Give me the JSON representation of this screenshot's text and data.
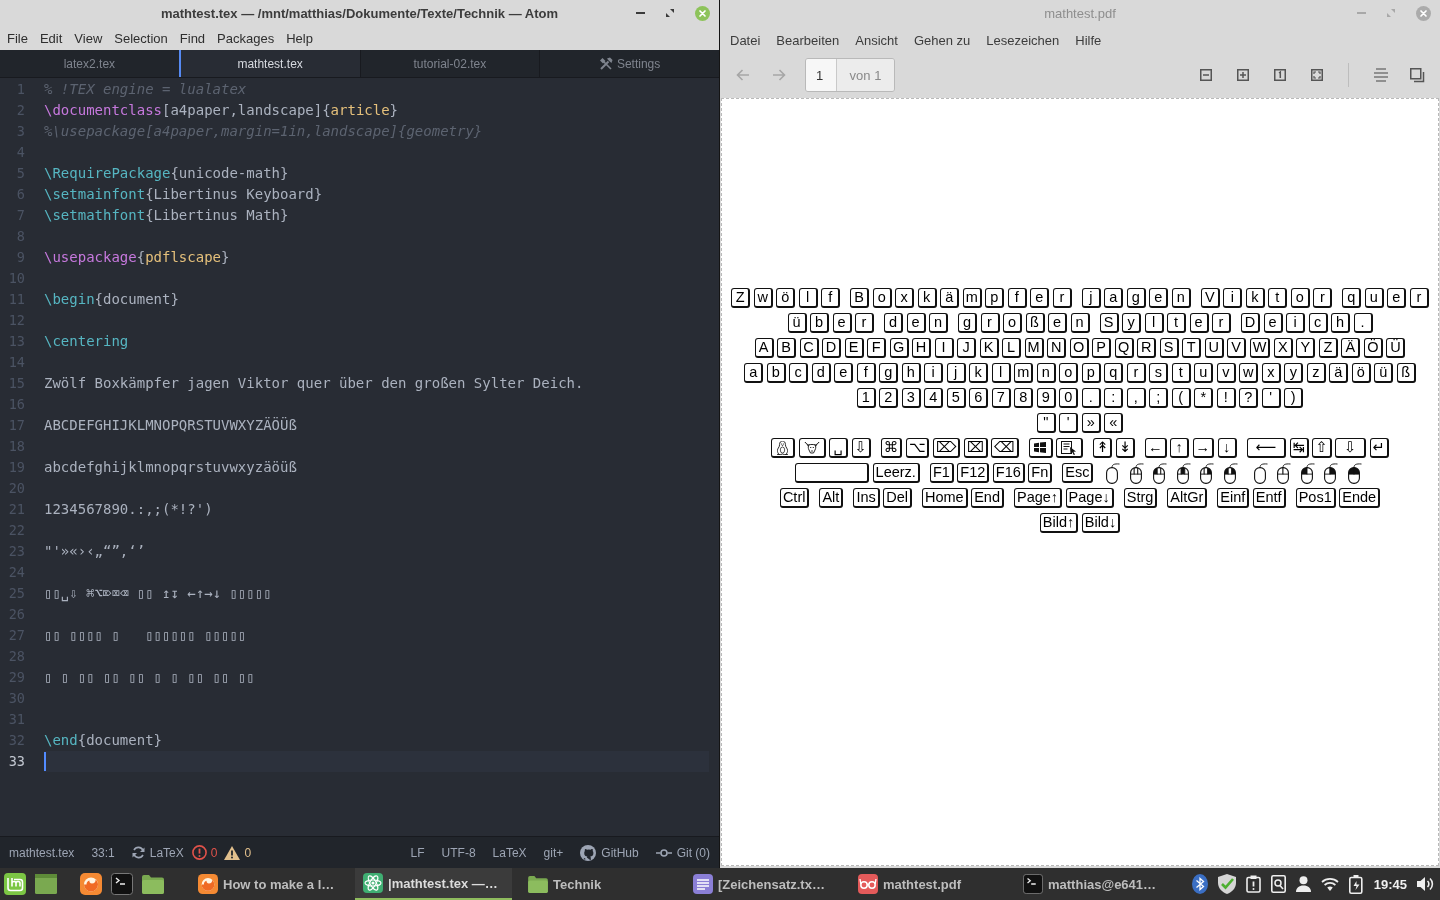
{
  "atom": {
    "window": {
      "title": "mathtest.tex — /mnt/matthias/Dokumente/Texte/Technik — Atom",
      "active": true
    },
    "menu": [
      "File",
      "Edit",
      "View",
      "Selection",
      "Find",
      "Packages",
      "Help"
    ],
    "tabs": [
      {
        "kind": "file",
        "label": "latex2.tex",
        "selected": false
      },
      {
        "kind": "file",
        "label": "mathtest.tex",
        "selected": true
      },
      {
        "kind": "file",
        "label": "tutorial-02.tex",
        "selected": false
      },
      {
        "kind": "settings",
        "label": "Settings",
        "selected": false
      }
    ],
    "lines": [
      {
        "number": "1",
        "current": false,
        "tokens": [
          {
            "kind": "comment",
            "text": "% !TEX engine = lualatex"
          }
        ]
      },
      {
        "number": "2",
        "current": false,
        "tokens": [
          {
            "kind": "keyword",
            "text": "\\documentclass"
          },
          {
            "kind": "text",
            "text": "[a4paper,landscape]{"
          },
          {
            "kind": "argument",
            "text": "article"
          },
          {
            "kind": "text",
            "text": "}"
          }
        ]
      },
      {
        "number": "3",
        "current": false,
        "tokens": [
          {
            "kind": "comment",
            "text": "%\\usepackage[a4paper,margin=1in,landscape]{geometry}"
          }
        ]
      },
      {
        "number": "4",
        "current": false
      },
      {
        "number": "5",
        "current": false,
        "tokens": [
          {
            "kind": "function",
            "text": "\\RequirePackage"
          },
          {
            "kind": "text",
            "text": "{unicode-math}"
          }
        ]
      },
      {
        "number": "6",
        "current": false,
        "tokens": [
          {
            "kind": "function",
            "text": "\\setmainfont"
          },
          {
            "kind": "text",
            "text": "{Libertinus Keyboard}"
          }
        ]
      },
      {
        "number": "7",
        "current": false,
        "tokens": [
          {
            "kind": "function",
            "text": "\\setmathfont"
          },
          {
            "kind": "text",
            "text": "{Libertinus Math}"
          }
        ]
      },
      {
        "number": "8",
        "current": false
      },
      {
        "number": "9",
        "current": false,
        "tokens": [
          {
            "kind": "keyword",
            "text": "\\usepackage"
          },
          {
            "kind": "text",
            "text": "{"
          },
          {
            "kind": "argument",
            "text": "pdflscape"
          },
          {
            "kind": "text",
            "text": "}"
          }
        ]
      },
      {
        "number": "10",
        "current": false
      },
      {
        "number": "11",
        "current": false,
        "tokens": [
          {
            "kind": "function",
            "text": "\\begin"
          },
          {
            "kind": "text",
            "text": "{document}"
          }
        ]
      },
      {
        "number": "12",
        "current": false
      },
      {
        "number": "13",
        "current": false,
        "tokens": [
          {
            "kind": "function",
            "text": "\\centering"
          }
        ]
      },
      {
        "number": "14",
        "current": false
      },
      {
        "number": "15",
        "current": false,
        "tokens": [
          {
            "kind": "text",
            "text": "Zwölf Boxkämpfer jagen Viktor quer über den großen Sylter Deich."
          }
        ]
      },
      {
        "number": "16",
        "current": false
      },
      {
        "number": "17",
        "current": false,
        "tokens": [
          {
            "kind": "text",
            "text": "ABCDEFGHIJKLMNOPQRSTUVWXYZÄÖÜß"
          }
        ]
      },
      {
        "number": "18",
        "current": false
      },
      {
        "number": "19",
        "current": false,
        "tokens": [
          {
            "kind": "text",
            "text": "abcdefghijklmnopqrstuvwxyzäöüß"
          }
        ]
      },
      {
        "number": "20",
        "current": false
      },
      {
        "number": "21",
        "current": false,
        "tokens": [
          {
            "kind": "text",
            "text": "1234567890.:,;(*!?')"
          }
        ]
      },
      {
        "number": "22",
        "current": false
      },
      {
        "number": "23",
        "current": false,
        "tokens": [
          {
            "kind": "text",
            "text": "\"'»«›‹„“”‚‘’"
          }
        ]
      },
      {
        "number": "24",
        "current": false
      },
      {
        "number": "25",
        "current": false,
        "tokens": [
          {
            "kind": "text",
            "text": "▯▯␣⇩ ⌘⌥⌦⌧⌫ ▯▯ ↥↧ ←↑→↓ ▯▯▯▯▯"
          }
        ]
      },
      {
        "number": "26",
        "current": false
      },
      {
        "number": "27",
        "current": false,
        "tokens": [
          {
            "kind": "text",
            "text": "▯▯ ▯▯▯▯ ▯   ▯▯▯▯▯▯ ▯▯▯▯▯"
          }
        ]
      },
      {
        "number": "28",
        "current": false
      },
      {
        "number": "29",
        "current": false,
        "tokens": [
          {
            "kind": "text",
            "text": "▯ ▯ ▯▯ ▯▯ ▯▯ ▯ ▯ ▯▯ ▯▯ ▯▯"
          }
        ]
      },
      {
        "number": "30",
        "current": false
      },
      {
        "number": "31",
        "current": false
      },
      {
        "number": "32",
        "current": false,
        "tokens": [
          {
            "kind": "function",
            "text": "\\end"
          },
          {
            "kind": "text",
            "text": "{document}"
          }
        ]
      },
      {
        "number": "33",
        "current": true
      }
    ],
    "status_bar": {
      "file": "mathtest.tex",
      "position": "33:1",
      "build": "LaTeX",
      "errors": "0",
      "warnings": "0",
      "line_ending": "LF",
      "encoding": "UTF-8",
      "grammar": "LaTeX",
      "git_plus": "git+",
      "github": "GitHub",
      "git": "Git (0)"
    }
  },
  "reader": {
    "window": {
      "title": "mathtest.pdf",
      "active": false
    },
    "menu": [
      "Datei",
      "Bearbeiten",
      "Ansicht",
      "Gehen zu",
      "Lesezeichen",
      "Hilfe"
    ],
    "toolbar": {
      "nav": [
        {
          "kind": "back",
          "disabled": true
        },
        {
          "kind": "forward",
          "disabled": true
        }
      ],
      "page": "1",
      "page_count": "von 1"
    },
    "keyboard": {
      "rows": [
        {
          "groups": [
            {
              "keys": [
                "Z",
                "w",
                "ö",
                "l",
                "f"
              ]
            },
            {
              "keys": [
                "B",
                "o",
                "x",
                "k",
                "ä",
                "m",
                "p",
                "f",
                "e",
                "r"
              ]
            },
            {
              "keys": [
                "j",
                "a",
                "g",
                "e",
                "n"
              ]
            },
            {
              "keys": [
                "V",
                "i",
                "k",
                "t",
                "o",
                "r"
              ]
            },
            {
              "keys": [
                "q",
                "u",
                "e",
                "r"
              ]
            }
          ]
        },
        {
          "groups": [
            {
              "keys": [
                "ü",
                "b",
                "e",
                "r"
              ]
            },
            {
              "keys": [
                "d",
                "e",
                "n"
              ]
            },
            {
              "keys": [
                "g",
                "r",
                "o",
                "ß",
                "e",
                "n"
              ]
            },
            {
              "keys": [
                "S",
                "y",
                "l",
                "t",
                "e",
                "r"
              ]
            },
            {
              "keys": [
                "D",
                "e",
                "i",
                "c",
                "h",
                "."
              ]
            }
          ]
        },
        {
          "groups": [
            {
              "keys": [
                "A",
                "B",
                "C",
                "D",
                "E",
                "F",
                "G",
                "H",
                "I",
                "J",
                "K",
                "L",
                "M",
                "N",
                "O",
                "P",
                "Q",
                "R",
                "S",
                "T",
                "U",
                "V",
                "W",
                "X",
                "Y",
                "Z",
                "Ä",
                "Ö",
                "Ü"
              ]
            }
          ]
        },
        {
          "groups": [
            {
              "keys": [
                "a",
                "b",
                "c",
                "d",
                "e",
                "f",
                "g",
                "h",
                "i",
                "j",
                "k",
                "l",
                "m",
                "n",
                "o",
                "p",
                "q",
                "r",
                "s",
                "t",
                "u",
                "v",
                "w",
                "x",
                "y",
                "z",
                "ä",
                "ö",
                "ü",
                "ß"
              ]
            }
          ]
        },
        {
          "groups": [
            {
              "keys": [
                "1",
                "2",
                "3",
                "4",
                "5",
                "6",
                "7",
                "8",
                "9",
                "0",
                ".",
                ":",
                ",",
                ";",
                "(",
                "*",
                "!",
                "?",
                "'",
                ")"
              ]
            }
          ]
        },
        {
          "groups": [
            {
              "keys": [
                "\"",
                "'",
                "»",
                "«"
              ]
            }
          ]
        },
        {
          "groups": [
            {
              "keys": [
                {
                  "kind": "penguin"
                },
                {
                  "kind": "gnu"
                },
                {
                  "kind": "text",
                  "label": "␣"
                },
                {
                  "kind": "text",
                  "label": "⇩"
                }
              ]
            },
            {
              "keys": [
                {
                  "kind": "text",
                  "label": "⌘"
                },
                {
                  "kind": "text",
                  "label": "⌥"
                },
                {
                  "kind": "text",
                  "label": "⌦"
                },
                {
                  "kind": "text",
                  "label": "⌧"
                },
                {
                  "kind": "text",
                  "label": "⌫"
                }
              ]
            },
            {
              "keys": [
                {
                  "kind": "flag"
                },
                {
                  "kind": "context"
                }
              ]
            },
            {
              "keys": [
                {
                  "kind": "text",
                  "label": "↟"
                },
                {
                  "kind": "text",
                  "label": "↡"
                }
              ]
            },
            {
              "keys": [
                {
                  "kind": "text",
                  "label": "←"
                },
                {
                  "kind": "text",
                  "label": "↑"
                },
                {
                  "kind": "text",
                  "label": "→"
                },
                {
                  "kind": "text",
                  "label": "↓"
                }
              ]
            },
            {
              "keys": [
                {
                  "kind": "wide",
                  "label": "⟵"
                },
                {
                  "kind": "text",
                  "label": "↹"
                },
                {
                  "kind": "text",
                  "label": "⇧"
                },
                {
                  "kind": "wide",
                  "label": "⇩"
                },
                {
                  "kind": "text",
                  "label": "↵"
                }
              ]
            }
          ]
        },
        {
          "groups": [
            {
              "keys": [
                {
                  "kind": "blank"
                },
                {
                  "kind": "text",
                  "label": "Leerz."
                }
              ]
            },
            {
              "keys": [
                {
                  "kind": "text",
                  "label": "F1"
                },
                {
                  "kind": "text",
                  "label": "F12"
                },
                {
                  "kind": "text",
                  "label": "F16"
                },
                {
                  "kind": "text",
                  "label": "Fn"
                }
              ]
            },
            {
              "keys": [
                {
                  "kind": "text",
                  "label": "Esc"
                }
              ]
            },
            {
              "keys": [
                {
                  "kind": "mouse"
                },
                {
                  "kind": "mouse",
                  "buttons": [
                    {
                      "pressed": false
                    },
                    {
                      "pressed": false
                    },
                    {
                      "pressed": false
                    }
                  ]
                },
                {
                  "kind": "mouse",
                  "buttons": [
                    {
                      "pressed": true
                    },
                    {
                      "pressed": false
                    },
                    {
                      "pressed": false
                    }
                  ]
                },
                {
                  "kind": "mouse",
                  "buttons": [
                    {
                      "pressed": false
                    },
                    {
                      "pressed": true
                    },
                    {
                      "pressed": false
                    }
                  ]
                },
                {
                  "kind": "mouse",
                  "buttons": [
                    {
                      "pressed": false
                    },
                    {
                      "pressed": false
                    },
                    {
                      "pressed": true
                    }
                  ]
                },
                {
                  "kind": "mouse",
                  "buttons": [
                    {
                      "pressed": true
                    },
                    {
                      "pressed": false
                    },
                    {
                      "pressed": true
                    }
                  ]
                }
              ]
            },
            {
              "keys": [
                {
                  "kind": "mouse"
                },
                {
                  "kind": "mouse",
                  "buttons": [
                    {
                      "pressed": false
                    },
                    {
                      "pressed": false
                    }
                  ]
                },
                {
                  "kind": "mouse",
                  "buttons": [
                    {
                      "pressed": true
                    },
                    {
                      "pressed": false
                    }
                  ]
                },
                {
                  "kind": "mouse",
                  "buttons": [
                    {
                      "pressed": false
                    },
                    {
                      "pressed": true
                    }
                  ]
                },
                {
                  "kind": "mouse",
                  "buttons": [
                    {
                      "pressed": true
                    },
                    {
                      "pressed": true
                    }
                  ]
                }
              ]
            }
          ]
        },
        {
          "groups": [
            {
              "keys": [
                "Ctrl"
              ]
            },
            {
              "keys": [
                "Alt"
              ]
            },
            {
              "keys": [
                "Ins",
                "Del"
              ]
            },
            {
              "keys": [
                "Home",
                "End"
              ]
            },
            {
              "keys": [
                "Page↑",
                "Page↓"
              ]
            },
            {
              "keys": [
                "Strg"
              ]
            },
            {
              "keys": [
                "AltGr"
              ]
            },
            {
              "keys": [
                "Einf",
                "Entf"
              ]
            },
            {
              "keys": [
                "Pos1",
                "Ende"
              ]
            }
          ]
        },
        {
          "groups": [
            {
              "keys": [
                "Bild↑",
                "Bild↓"
              ]
            }
          ]
        }
      ]
    }
  },
  "taskbar": {
    "windows": [
      {
        "kind": "browser",
        "label": "How to make a l…",
        "selected": false
      },
      {
        "kind": "atom",
        "label": "|mathtest.tex —…",
        "selected": true
      },
      {
        "kind": "folder",
        "label": "Technik",
        "selected": false
      },
      {
        "kind": "notes",
        "label": "[Zeichensatz.tx…",
        "selected": false
      },
      {
        "kind": "pdf",
        "label": "mathtest.pdf",
        "selected": false
      },
      {
        "kind": "terminal",
        "label": "matthias@e641…",
        "selected": false
      }
    ],
    "clock": "19:45"
  }
}
